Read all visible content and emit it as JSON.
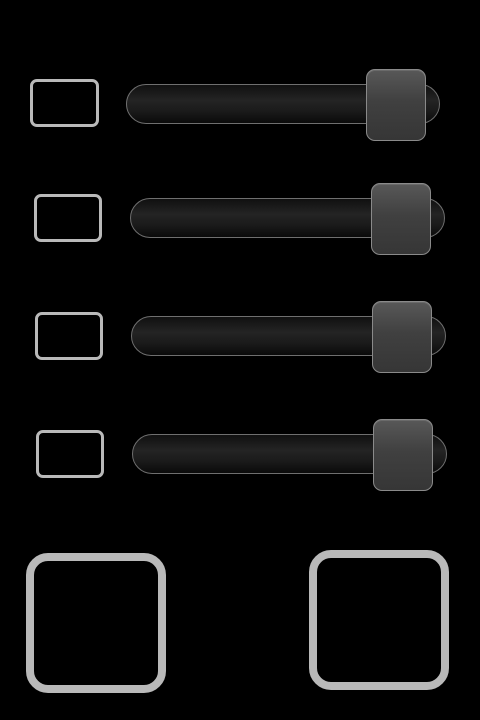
{
  "controls": {
    "rows": [
      {
        "checked": false,
        "level": 1.0
      },
      {
        "checked": false,
        "level": 1.0
      },
      {
        "checked": false,
        "level": 1.0
      },
      {
        "checked": false,
        "level": 1.0
      }
    ],
    "buttons": [
      {
        "name": "left"
      },
      {
        "name": "right"
      }
    ]
  },
  "colors": {
    "background": "#000000",
    "outline": "#b9b9b9",
    "track": "#1e1e1e",
    "thumb": "#454545"
  }
}
